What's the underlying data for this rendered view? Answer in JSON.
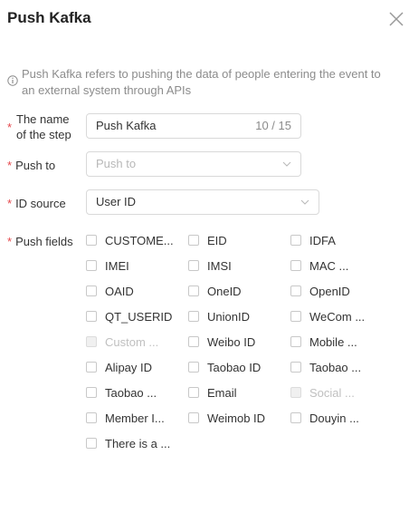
{
  "dialog": {
    "title": "Push Kafka",
    "close_icon": "close-icon"
  },
  "info": {
    "icon": "info-icon",
    "text": "Push Kafka refers to pushing the data of people entering the event to an external system through APIs"
  },
  "form": {
    "step_name": {
      "label_line1": "The name",
      "label_line2": "of the step",
      "value": "Push Kafka",
      "counter": "10 / 15"
    },
    "push_to": {
      "label": "Push to",
      "placeholder": "Push to"
    },
    "id_source": {
      "label": "ID source",
      "value": "User ID"
    },
    "push_fields": {
      "label": "Push fields",
      "options": [
        {
          "label": "CUSTOME...",
          "disabled": false
        },
        {
          "label": "EID",
          "disabled": false
        },
        {
          "label": "IDFA",
          "disabled": false
        },
        {
          "label": "IMEI",
          "disabled": false
        },
        {
          "label": "IMSI",
          "disabled": false
        },
        {
          "label": "MAC ...",
          "disabled": false
        },
        {
          "label": "OAID",
          "disabled": false
        },
        {
          "label": "OneID",
          "disabled": false
        },
        {
          "label": "OpenID",
          "disabled": false
        },
        {
          "label": "QT_USERID",
          "disabled": false
        },
        {
          "label": "UnionID",
          "disabled": false
        },
        {
          "label": "WeCom ...",
          "disabled": false
        },
        {
          "label": "Custom ...",
          "disabled": true
        },
        {
          "label": "Weibo ID",
          "disabled": false
        },
        {
          "label": "Mobile ...",
          "disabled": false
        },
        {
          "label": "Alipay ID",
          "disabled": false
        },
        {
          "label": "Taobao ID",
          "disabled": false
        },
        {
          "label": "Taobao ...",
          "disabled": false
        },
        {
          "label": "Taobao ...",
          "disabled": false
        },
        {
          "label": "Email",
          "disabled": false
        },
        {
          "label": "Social ...",
          "disabled": true
        },
        {
          "label": "Member I...",
          "disabled": false
        },
        {
          "label": "Weimob ID",
          "disabled": false
        },
        {
          "label": "Douyin ...",
          "disabled": false
        },
        {
          "label": "There is a ...",
          "disabled": false
        }
      ]
    }
  }
}
